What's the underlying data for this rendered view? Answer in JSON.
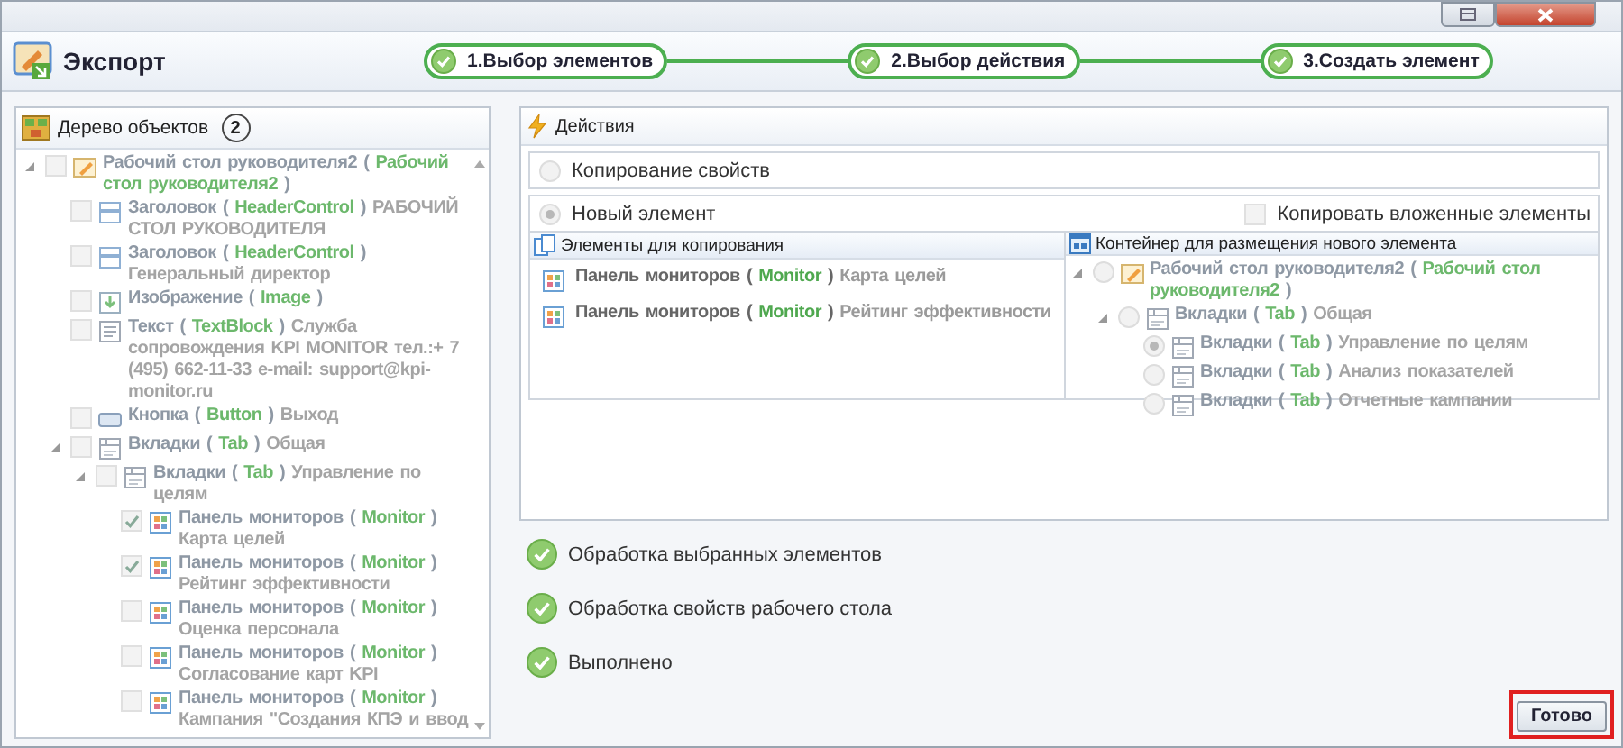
{
  "window": {
    "title": "Экспорт"
  },
  "steps": [
    {
      "label": "1.Выбор элементов",
      "completed": true
    },
    {
      "label": "2.Выбор действия",
      "completed": true
    },
    {
      "label": "3.Создать элемент",
      "completed": true
    }
  ],
  "object_tree": {
    "title": "Дерево объектов",
    "badge": "2",
    "disabled": true,
    "nodes": [
      {
        "kind": "desktop",
        "title": [
          "Рабочий стол руководителя2 (",
          "Рабочий стол руководителя2",
          ")"
        ],
        "checked": false,
        "expanded": true,
        "children": [
          {
            "kind": "header",
            "title": [
              "Заголовок (",
              "HeaderControl",
              ")"
            ],
            "detail": "РАБОЧИЙ СТОЛ РУКОВОДИТЕЛЯ",
            "checked": false
          },
          {
            "kind": "header",
            "title": [
              "Заголовок (",
              "HeaderControl",
              ")"
            ],
            "detail": "Генеральный  директор",
            "checked": false
          },
          {
            "kind": "image",
            "title": [
              "Изображение (",
              "Image",
              ")"
            ],
            "checked": false
          },
          {
            "kind": "text",
            "title": [
              "Текст (",
              "TextBlock",
              ")"
            ],
            "detail": "Служба сопровождения KPI MONITOR тел.:+ 7 (495) 662-11-33 e-mail: support@kpi-monitor.ru",
            "checked": false
          },
          {
            "kind": "button",
            "title": [
              "Кнопка (",
              "Button",
              ")"
            ],
            "detail": "Выход",
            "checked": false
          },
          {
            "kind": "tabs",
            "title": [
              "Вкладки (",
              "Tab",
              ")"
            ],
            "detail": "Общая",
            "checked": false,
            "expanded": true,
            "children": [
              {
                "kind": "tabs",
                "title": [
                  "Вкладки (",
                  "Tab",
                  ")"
                ],
                "detail": "Управление по целям",
                "checked": false,
                "expanded": true,
                "children": [
                  {
                    "kind": "monitor",
                    "title": [
                      "Панель мониторов (",
                      "Monitor",
                      ")"
                    ],
                    "detail": "Карта целей",
                    "checked": true
                  },
                  {
                    "kind": "monitor",
                    "title": [
                      "Панель мониторов (",
                      "Monitor",
                      ")"
                    ],
                    "detail": "Рейтинг эффективности",
                    "checked": true
                  },
                  {
                    "kind": "monitor",
                    "title": [
                      "Панель мониторов (",
                      "Monitor",
                      ")"
                    ],
                    "detail": "Оценка персонала",
                    "checked": false
                  },
                  {
                    "kind": "monitor",
                    "title": [
                      "Панель мониторов (",
                      "Monitor",
                      ")"
                    ],
                    "detail": "Согласование карт KPI",
                    "checked": false
                  },
                  {
                    "kind": "monitor",
                    "title": [
                      "Панель мониторов (",
                      "Monitor",
                      ")"
                    ],
                    "detail": "Кампания \"Создания КПЭ и ввод",
                    "checked": false
                  }
                ]
              }
            ]
          }
        ]
      }
    ]
  },
  "actions": {
    "title": "Действия",
    "copy_properties": {
      "label": "Копирование свойств",
      "selected": false
    },
    "new_element": {
      "label": "Новый элемент",
      "selected": true
    },
    "copy_nested": {
      "label": "Копировать вложенные элементы",
      "checked": false
    },
    "copy_list": {
      "title": "Элементы для копирования",
      "items": [
        {
          "kind": "monitor",
          "title": [
            "Панель мониторов (",
            "Monitor",
            ")"
          ],
          "detail": "Карта целей"
        },
        {
          "kind": "monitor",
          "title": [
            "Панель мониторов (",
            "Monitor",
            ")"
          ],
          "detail": "Рейтинг эффективности"
        }
      ]
    },
    "container_tree": {
      "title": "Контейнер для размещения нового элемента",
      "disabled": true,
      "nodes": [
        {
          "kind": "desktop",
          "title": [
            "Рабочий стол руководителя2 (",
            "Рабочий стол руководителя2",
            ")"
          ],
          "selected": false,
          "expanded": true,
          "children": [
            {
              "kind": "tabs",
              "title": [
                "Вкладки (",
                "Tab",
                ")"
              ],
              "detail": "Общая",
              "selected": false,
              "expanded": true,
              "children": [
                {
                  "kind": "tabs",
                  "title": [
                    "Вкладки (",
                    "Tab",
                    ")"
                  ],
                  "detail": "Управление по целям",
                  "selected": true
                },
                {
                  "kind": "tabs",
                  "title": [
                    "Вкладки (",
                    "Tab",
                    ")"
                  ],
                  "detail": "Анализ показателей",
                  "selected": false
                },
                {
                  "kind": "tabs",
                  "title": [
                    "Вкладки (",
                    "Tab",
                    ")"
                  ],
                  "detail": "Отчетные кампании",
                  "selected": false
                }
              ]
            }
          ]
        }
      ]
    }
  },
  "statuses": [
    {
      "label": "Обработка выбранных элементов",
      "done": true
    },
    {
      "label": "Обработка свойств рабочего стола",
      "done": true
    },
    {
      "label": "Выполнено",
      "done": true
    }
  ],
  "done_button": {
    "label": "Готово",
    "highlighted": true
  }
}
